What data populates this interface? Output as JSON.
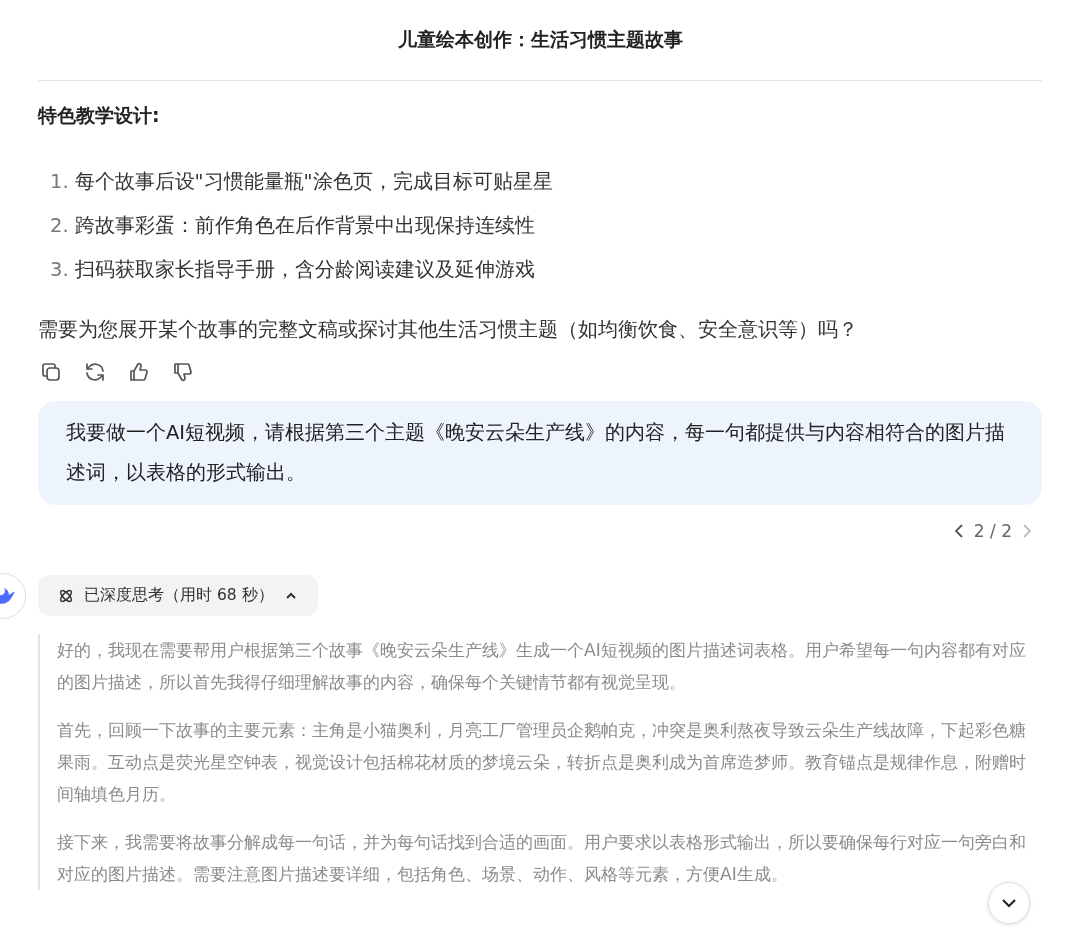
{
  "title": "儿童绘本创作：生活习惯主题故事",
  "section_heading": "特色教学设计:",
  "list": [
    {
      "marker": "1.",
      "text": "每个故事后设\"习惯能量瓶\"涂色页，完成目标可贴星星"
    },
    {
      "marker": "2.",
      "text": "跨故事彩蛋：前作角色在后作背景中出现保持连续性"
    },
    {
      "marker": "3.",
      "text": "扫码获取家长指导手册，含分龄阅读建议及延伸游戏"
    }
  ],
  "closing": "需要为您展开某个故事的完整文稿或探讨其他生活习惯主题（如均衡饮食、安全意识等）吗？",
  "actions": [
    {
      "kind": "copy"
    },
    {
      "kind": "regenerate"
    },
    {
      "kind": "like"
    },
    {
      "kind": "dislike"
    }
  ],
  "user_message": "我要做一个AI短视频，请根据第三个主题《晚安云朵生产线》的内容，每一句都提供与内容相符合的图片描述词，以表格的形式输出。",
  "pager": {
    "label": "2 / 2",
    "prev_disabled": false,
    "next_disabled": true
  },
  "thinking": {
    "label": "已深度思考（用时 68 秒）",
    "expanded": true,
    "paragraphs": [
      "好的，我现在需要帮用户根据第三个故事《晚安云朵生产线》生成一个AI短视频的图片描述词表格。用户希望每一句内容都有对应的图片描述，所以首先我得仔细理解故事的内容，确保每个关键情节都有视觉呈现。",
      "首先，回顾一下故事的主要元素：主角是小猫奥利，月亮工厂管理员企鹅帕克，冲突是奥利熬夜导致云朵生产线故障，下起彩色糖果雨。互动点是荧光星空钟表，视觉设计包括棉花材质的梦境云朵，转折点是奥利成为首席造梦师。教育锚点是规律作息，附赠时间轴填色月历。",
      "接下来，我需要将故事分解成每一句话，并为每句话找到合适的画面。用户要求以表格形式输出，所以要确保每行对应一句旁白和对应的图片描述。需要注意图片描述要详细，包括角色、场景、动作、风格等元素，方便AI生成。"
    ]
  }
}
